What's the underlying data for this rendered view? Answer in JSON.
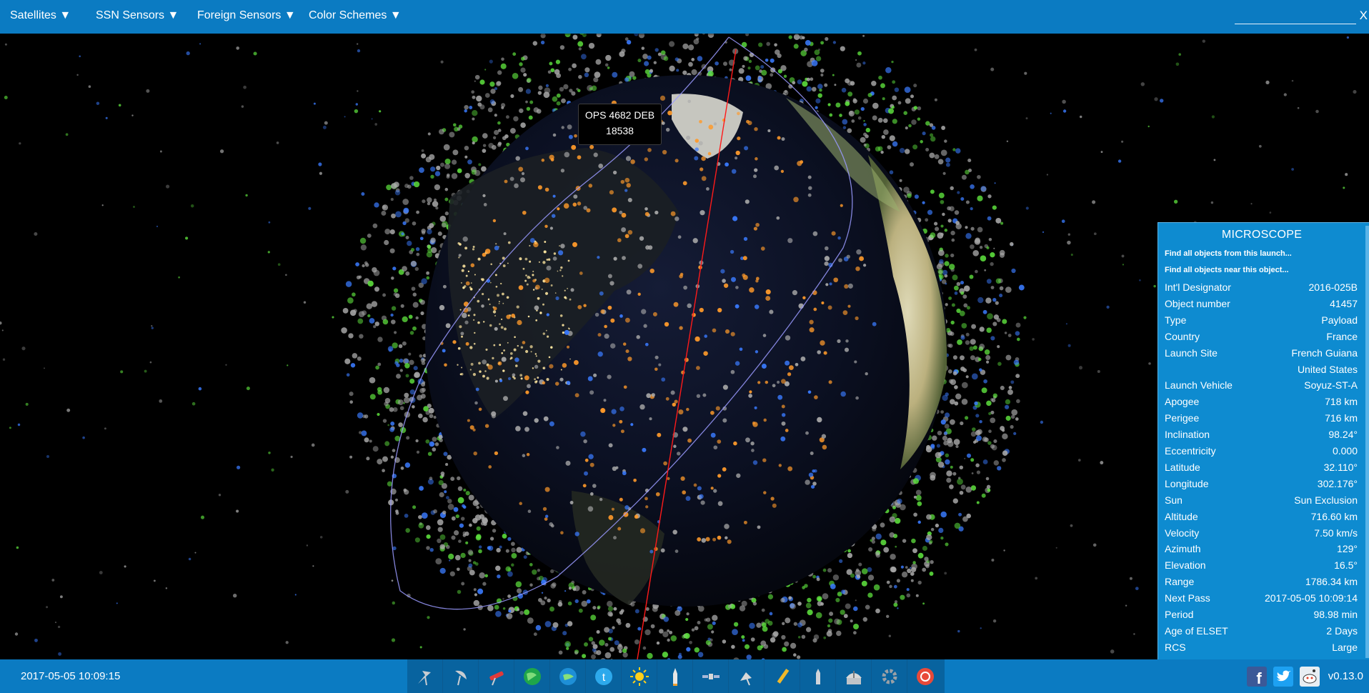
{
  "nav": {
    "menus": [
      {
        "label": "Satellites ▼"
      },
      {
        "label": "SSN Sensors ▼"
      },
      {
        "label": "Foreign Sensors ▼"
      },
      {
        "label": "Color Schemes ▼"
      }
    ],
    "search": {
      "value": "",
      "placeholder": ""
    },
    "clear_label": "X"
  },
  "tooltip": {
    "name": "OPS 4682 DEB",
    "number": "18538"
  },
  "infobox": {
    "title": "MICROSCOPE",
    "links": [
      {
        "label": "Find all objects from this launch..."
      },
      {
        "label": "Find all objects near this object..."
      }
    ],
    "rows": [
      {
        "key": "Int'l Designator",
        "value": "2016-025B"
      },
      {
        "key": "Object number",
        "value": "41457"
      },
      {
        "key": "Type",
        "value": "Payload"
      },
      {
        "key": "Country",
        "value": "France"
      },
      {
        "key": "Launch Site",
        "value": "French Guiana"
      },
      {
        "key": "",
        "value": "United States"
      },
      {
        "key": "Launch Vehicle",
        "value": "Soyuz-ST-A"
      },
      {
        "key": "Apogee",
        "value": "718 km"
      },
      {
        "key": "Perigee",
        "value": "716 km"
      },
      {
        "key": "Inclination",
        "value": "98.24°"
      },
      {
        "key": "Eccentricity",
        "value": "0.000"
      },
      {
        "key": "Latitude",
        "value": "32.110°"
      },
      {
        "key": "Longitude",
        "value": "302.176°"
      },
      {
        "key": "Sun",
        "value": "Sun Exclusion"
      },
      {
        "key": "Altitude",
        "value": "716.60 km"
      },
      {
        "key": "Velocity",
        "value": "7.50 km/s"
      },
      {
        "key": "Azimuth",
        "value": "129°"
      },
      {
        "key": "Elevation",
        "value": "16.5°"
      },
      {
        "key": "Range",
        "value": "1786.34 km"
      },
      {
        "key": "Next Pass",
        "value": "2017-05-05 10:09:14"
      },
      {
        "key": "Period",
        "value": "98.98 min"
      },
      {
        "key": "Age of ELSET",
        "value": "2 Days"
      },
      {
        "key": "RCS",
        "value": "Large"
      }
    ]
  },
  "bottom": {
    "datetime": "2017-05-05 10:09:15",
    "version": "v0.13.0",
    "toolbar_icons": [
      "sensor-dish-icon",
      "radar-dish-icon",
      "telescope-icon",
      "earth-green-icon",
      "earth-blue-icon",
      "twitter-bird-icon",
      "sun-icon",
      "rocket-icon",
      "satellite-icon",
      "satellite-dish-icon",
      "pencil-icon",
      "rocket-small-icon",
      "observatory-icon",
      "gear-icon",
      "radar-sweep-icon"
    ],
    "social_icons": [
      "facebook-icon",
      "twitter-icon",
      "reddit-icon"
    ]
  },
  "colors": {
    "nav_bg": "#0b7bc2",
    "panel_bg": "#0e8bd0",
    "payload": "#ff9a2a",
    "rocket_body": "#5de03d",
    "debris": "#a9a9a9",
    "sensor": "#3a7bff",
    "orbit_line": "#9a9aff",
    "line_of_sight": "#ff1a1a"
  }
}
